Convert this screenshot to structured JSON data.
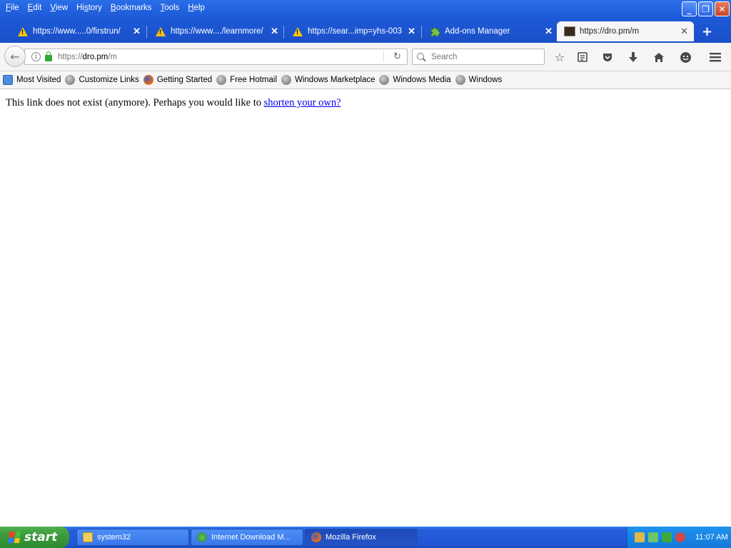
{
  "menu": [
    {
      "acc": "F",
      "rest": "ile"
    },
    {
      "acc": "E",
      "rest": "dit"
    },
    {
      "acc": "V",
      "rest": "iew"
    },
    {
      "acc": "",
      "rest": "History",
      "prefix": "Hi",
      "accMid": "s",
      "suffix": "tory"
    },
    {
      "acc": "B",
      "rest": "ookmarks"
    },
    {
      "acc": "T",
      "rest": "ools"
    },
    {
      "acc": "H",
      "rest": "elp"
    }
  ],
  "menu_labels": [
    "File",
    "Edit",
    "View",
    "History",
    "Bookmarks",
    "Tools",
    "Help"
  ],
  "window_buttons": {
    "minimize": "_",
    "restore": "❐",
    "close": "✕"
  },
  "tabs": [
    {
      "title": "https://www.....0/firstrun/",
      "icon": "warning-icon",
      "close": "✕"
    },
    {
      "title": "https://www..../learnmore/",
      "icon": "warning-icon",
      "close": "✕"
    },
    {
      "title": "https://sear...imp=yhs-003",
      "icon": "warning-icon",
      "close": "✕"
    },
    {
      "title": "Add-ons Manager",
      "icon": "puzzle-icon",
      "close": "✕"
    },
    {
      "title": "https://dro.pm/m",
      "icon": "site-icon",
      "close": "✕"
    }
  ],
  "new_tab": "+",
  "url": {
    "scheme": "https://",
    "host": "dro.pm",
    "path": "/m"
  },
  "search": {
    "placeholder": "Search"
  },
  "bookmarks": [
    "Most Visited",
    "Customize Links",
    "Getting Started",
    "Free Hotmail",
    "Windows Marketplace",
    "Windows Media",
    "Windows"
  ],
  "page": {
    "message": "This link does not exist (anymore). Perhaps you would like to ",
    "link": "shorten your own?"
  },
  "taskbar": {
    "start": "start",
    "tasks": [
      "system32",
      "Internet Download M...",
      "Mozilla Firefox"
    ],
    "clock": "11:07 AM"
  }
}
